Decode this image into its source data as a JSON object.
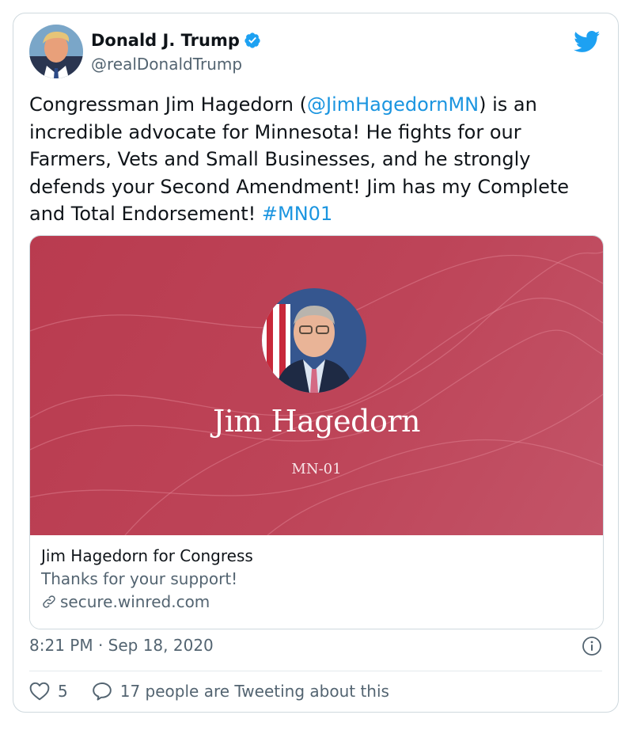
{
  "author": {
    "name": "Donald J. Trump",
    "handle": "@realDonaldTrump",
    "verified": true
  },
  "tweet": {
    "text_before_mention": "Congressman Jim Hagedorn (",
    "mention": "@JimHagedornMN",
    "text_after_mention": ") is an incredible advocate for Minnesota! He fights for our Farmers, Vets and Small Businesses, and he strongly defends your Second Amendment! Jim has my Complete and Total Endorsement! ",
    "hashtag": "#MN01"
  },
  "card": {
    "image_name": "Jim Hagedorn",
    "image_district": "MN-01",
    "title": "Jim Hagedorn for Congress",
    "description": "Thanks for your support!",
    "domain": "secure.winred.com"
  },
  "meta": {
    "timestamp": "8:21 PM · Sep 18, 2020"
  },
  "engagement": {
    "likes": "5",
    "tweeting_text": "17 people are Tweeting about this"
  },
  "colors": {
    "link": "#1b95e0",
    "twitter_blue": "#1da1f2",
    "card_red": "#bd4458",
    "secondary_text": "#536471"
  },
  "icons": [
    "verified-badge-icon",
    "twitter-bird-icon",
    "link-icon",
    "info-icon",
    "heart-icon",
    "speech-bubble-icon"
  ]
}
